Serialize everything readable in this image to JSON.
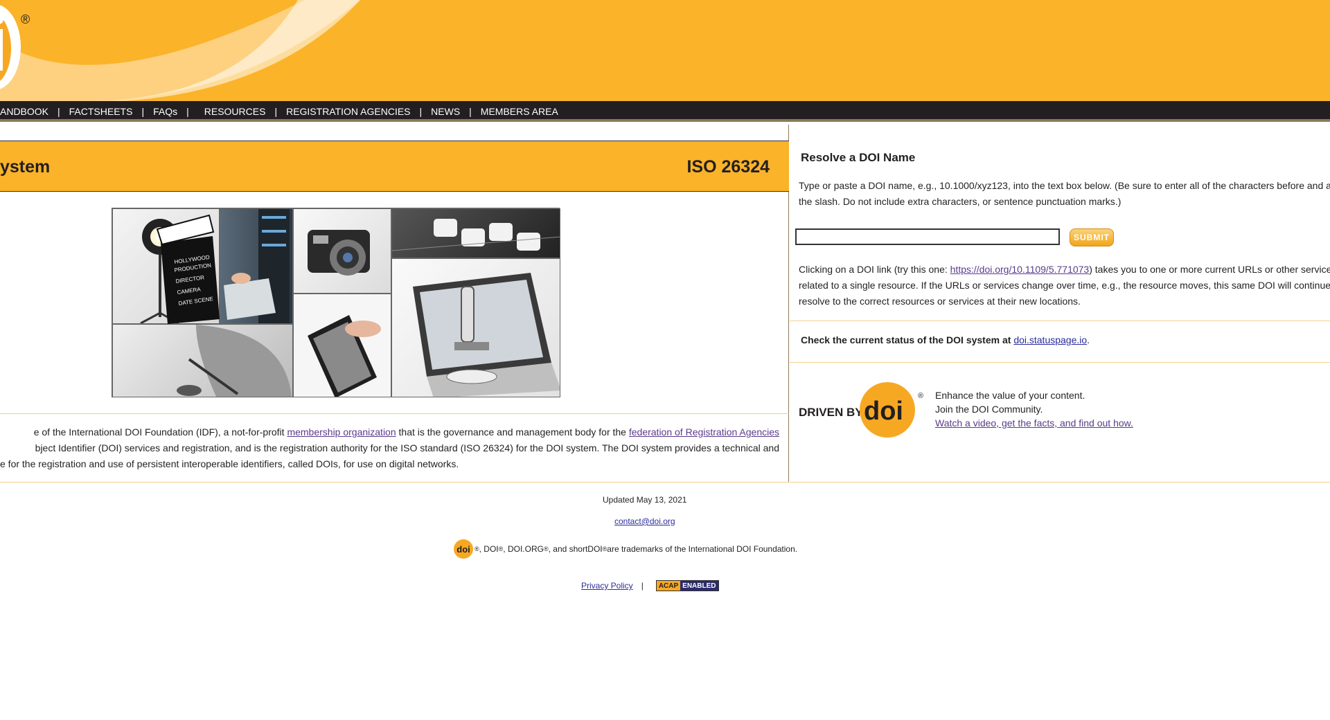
{
  "header": {
    "registered": "®"
  },
  "nav": {
    "items": [
      "ANDBOOK",
      "FACTSHEETS",
      "FAQs",
      "RESOURCES",
      "REGISTRATION AGENCIES",
      "NEWS",
      "MEMBERS AREA"
    ],
    "separator": "|"
  },
  "banner": {
    "title": "ystem",
    "iso": "ISO 26324"
  },
  "collage": {
    "tiles": [
      "film-light",
      "hollywood-clapboard",
      "server-laptop",
      "camera",
      "keyboard-keys",
      "satellite-dish",
      "tablet-hand",
      "microscope-laptop"
    ],
    "clapboard_text": "HOLLYWOOD PRODUCTION DIRECTOR CAMERA DATE SCENE"
  },
  "intro": {
    "line1_pre": "e of the International DOI Foundation (IDF), a not-for-profit ",
    "link1": "membership organization",
    "line1_mid": " that is the governance and management body for the ",
    "link2": "federation of Registration Agencies",
    "line2": "bject Identifier (DOI) services and registration, and is the registration authority for the ISO standard (ISO 26324) for the DOI system. The DOI system provides a technical and",
    "line3": "e for the registration and use of persistent interoperable identifiers, called DOIs, for use on digital networks."
  },
  "resolve": {
    "title": "Resolve a DOI Name",
    "help_line1": "Type or paste a DOI name, e.g., 10.1000/xyz123, into the text box below. (Be sure to enter all of the characters before and after",
    "help_line2": "the slash. Do not include extra characters, or sentence punctuation marks.)",
    "input_value": "",
    "submit": "SUBMIT",
    "click_pre": "Clicking on a DOI link (try this one: ",
    "click_link": "https://doi.org/10.1109/5.771073",
    "click_post": ") takes you to one or more current URLs or other services",
    "click_line2": "related to a single resource. If the URLs or services change over time, e.g., the resource moves, this same DOI will continue to",
    "click_line3": "resolve to the correct resources or services at their new locations."
  },
  "status": {
    "label": "Check the current status of the DOI system at ",
    "link": "doi.statuspage.io",
    "suffix": "."
  },
  "driven": {
    "logo_text": "DRIVEN BY",
    "logo_doi": "doi",
    "reg": "®",
    "line1": "Enhance the value of your content.",
    "line2": "Join the DOI Community.",
    "link": "Watch a video, get the facts, and find out how."
  },
  "footer": {
    "updated": "Updated May 13, 2021",
    "contact": "contact@doi.org",
    "logo": "doi",
    "tm_doi": ", DOI",
    "tm_doiorg": ", DOI.ORG",
    "tm_short": ", and shortDOI",
    "tm_tail": " are trademarks of the International DOI Foundation.",
    "reg": "®",
    "privacy": "Privacy Policy",
    "pipe": "|",
    "acap_1": "ACAP",
    "acap_2": "ENABLED"
  },
  "colors": {
    "brand_orange": "#fbb32a",
    "nav_dark": "#231f20",
    "link_purple": "#5b3a8a"
  }
}
